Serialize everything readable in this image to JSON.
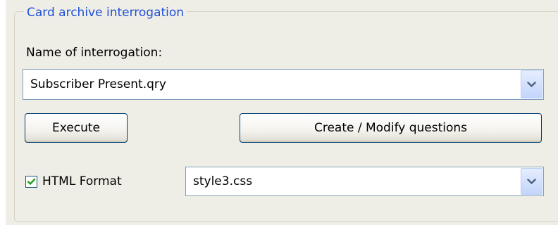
{
  "group": {
    "title": "Card archive interrogation"
  },
  "interrogation": {
    "label": "Name of interrogation:",
    "selected": "Subscriber Present.qry"
  },
  "buttons": {
    "execute": "Execute",
    "create_modify": "Create / Modify questions"
  },
  "html_format": {
    "label": "HTML Format",
    "checked": true,
    "stylesheet": "style3.css"
  },
  "colors": {
    "panel_background": "#efeee6",
    "group_title": "#1f4fd8",
    "checkmark": "#21a121",
    "field_border": "#7f9db9",
    "button_border": "#003c74",
    "dropdown_arrow": "#4d6185"
  },
  "icons": {
    "dropdown": "chevron-down-icon",
    "check": "checkmark-icon"
  }
}
